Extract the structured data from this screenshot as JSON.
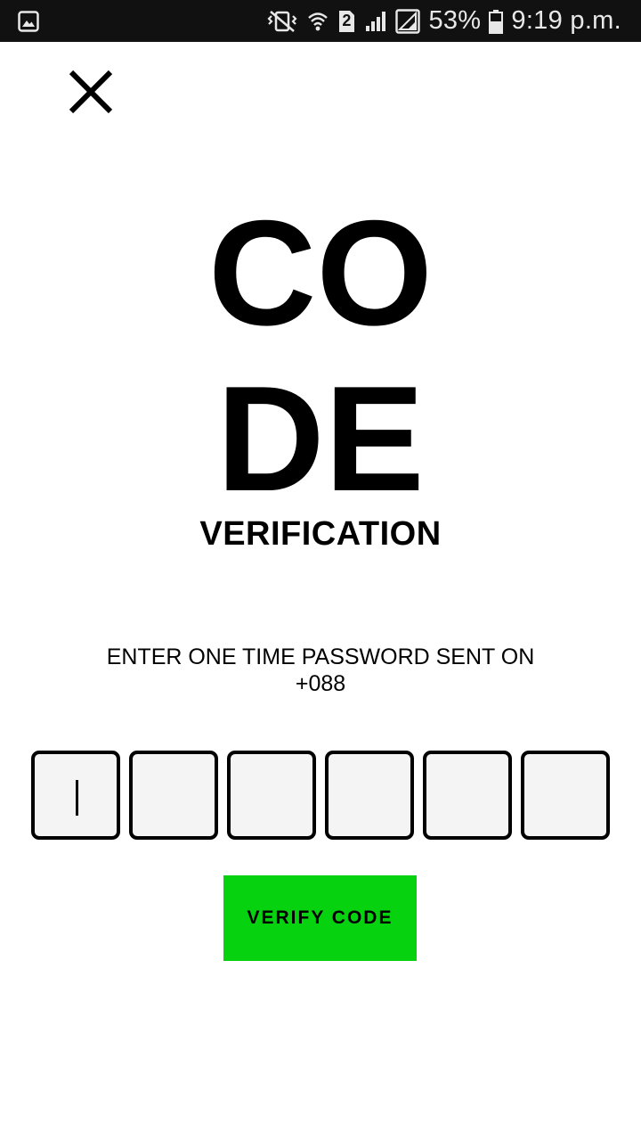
{
  "status_bar": {
    "battery_percent": "53%",
    "time": "9:19 p.m.",
    "sim_slot": "2",
    "icons": [
      "gallery-icon",
      "vibrate-icon",
      "wifi-icon",
      "sim-2-badge-icon",
      "signal-icon",
      "signal-icon",
      "battery-icon"
    ]
  },
  "header": {
    "close_icon": "close-icon"
  },
  "title": {
    "line1": "CO",
    "line2": "DE",
    "subtitle": "VERIFICATION"
  },
  "prompt": {
    "line1": "ENTER ONE TIME PASSWORD SENT ON",
    "line2": "+088"
  },
  "otp": {
    "digits": [
      "",
      "",
      "",
      "",
      "",
      ""
    ],
    "focused_index": 0
  },
  "actions": {
    "verify_label": "VERIFY CODE",
    "verify_color": "#07d210"
  }
}
